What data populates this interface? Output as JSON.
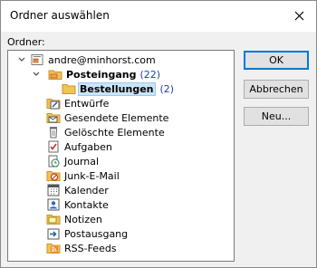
{
  "window": {
    "title": "Ordner auswählen"
  },
  "folder_label": "Ordner:",
  "tree": {
    "root": {
      "label": "andre@minhorst.com"
    },
    "inbox": {
      "label": "Posteingang",
      "count": "(22)"
    },
    "selected": {
      "label": "Bestellungen",
      "count": "(2)"
    },
    "items": [
      {
        "label": "Entwürfe",
        "icon": "drafts-icon"
      },
      {
        "label": "Gesendete Elemente",
        "icon": "sent-items-icon"
      },
      {
        "label": "Gelöschte Elemente",
        "icon": "trash-icon"
      },
      {
        "label": "Aufgaben",
        "icon": "tasks-icon"
      },
      {
        "label": "Journal",
        "icon": "journal-icon"
      },
      {
        "label": "Junk-E-Mail",
        "icon": "junk-icon"
      },
      {
        "label": "Kalender",
        "icon": "calendar-icon"
      },
      {
        "label": "Kontakte",
        "icon": "contacts-icon"
      },
      {
        "label": "Notizen",
        "icon": "notes-icon"
      },
      {
        "label": "Postausgang",
        "icon": "outbox-icon"
      },
      {
        "label": "RSS-Feeds",
        "icon": "rss-icon"
      }
    ]
  },
  "buttons": {
    "ok": "OK",
    "cancel": "Abbrechen",
    "new": "Neu..."
  }
}
